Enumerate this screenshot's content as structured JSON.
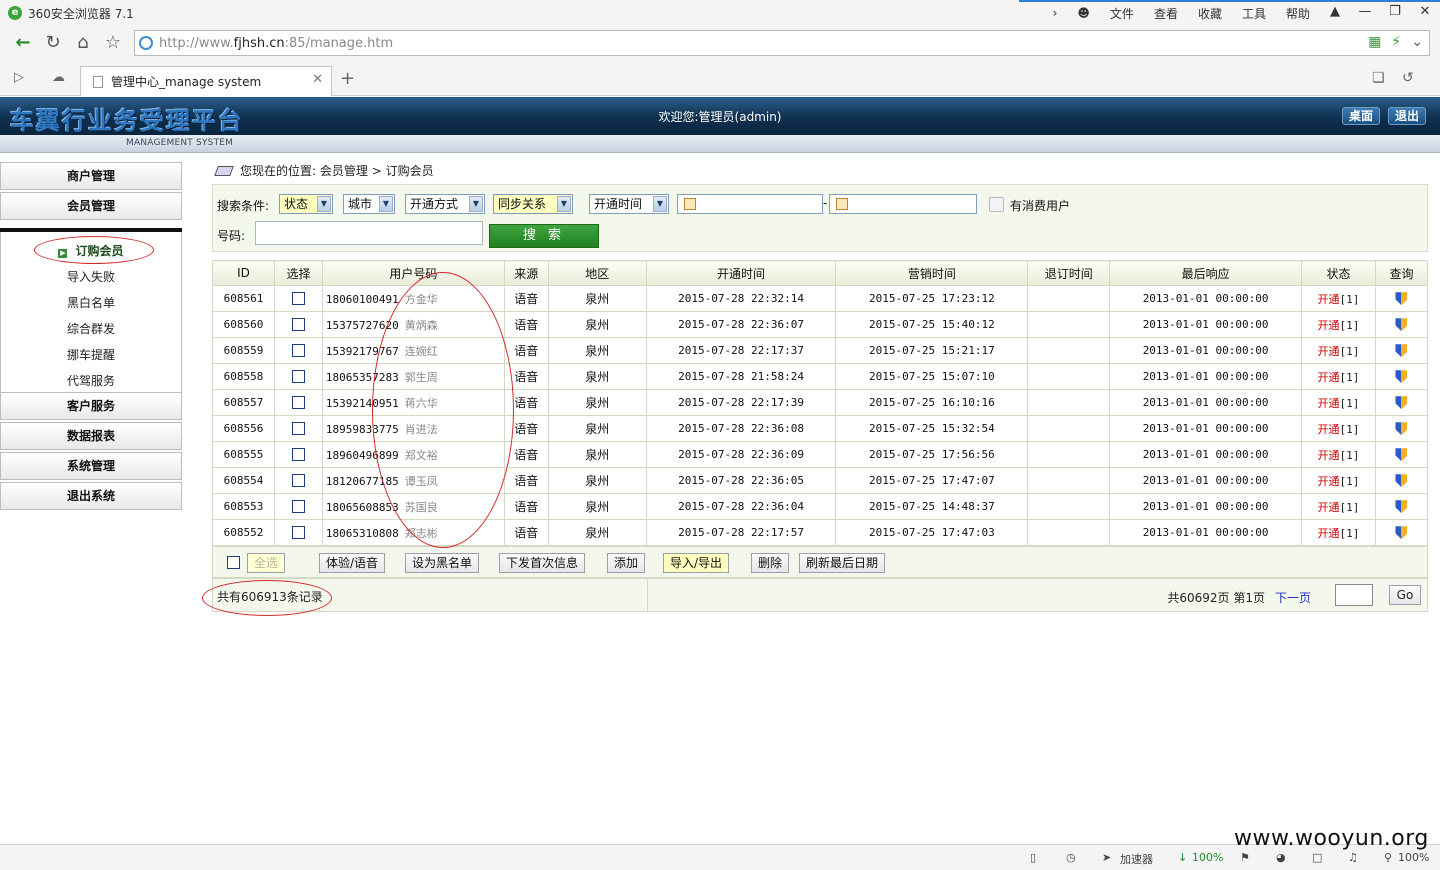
{
  "browser": {
    "app_title": "360安全浏览器 7.1",
    "menu": [
      "文件",
      "查看",
      "收藏",
      "工具",
      "帮助"
    ],
    "url_prefix": "http://www.",
    "url_domain": "fjhsh.cn",
    "url_suffix": ":85/manage.htm",
    "tab_title": "管理中心_manage system"
  },
  "header": {
    "brand": "车翼行业务受理平台",
    "subtitle": "MANAGEMENT SYSTEM",
    "welcome": "欢迎您:管理员(admin)",
    "desktop_btn": "桌面",
    "logout_btn": "退出"
  },
  "sidebar": {
    "top": [
      "商户管理",
      "会员管理"
    ],
    "sub": [
      "订购会员",
      "导入失败",
      "黑白名单",
      "综合群发",
      "挪车提醒",
      "代驾服务"
    ],
    "bottom": [
      "客户服务",
      "数据报表",
      "系统管理",
      "退出系统"
    ]
  },
  "breadcrumb": {
    "prefix": "您现在的位置:",
    "level1": "会员管理",
    "sep": ">",
    "level2": "订购会员"
  },
  "search": {
    "label": "搜索条件:",
    "status": "状态",
    "city": "城市",
    "open_method": "开通方式",
    "sync": "同步关系",
    "open_time": "开通时间",
    "dash": "-",
    "consume_label": "有消费用户",
    "number_label": "号码:",
    "button": "搜 索"
  },
  "table": {
    "headers": [
      "ID",
      "选择",
      "用户号码",
      "来源",
      "地区",
      "开通时间",
      "营销时间",
      "退订时间",
      "最后响应",
      "状态",
      "查询"
    ],
    "rows": [
      {
        "id": "608561",
        "phone": "18060100491",
        "name": "方金华",
        "source": "语音",
        "region": "泉州",
        "open_time": "2015-07-28 22:32:14",
        "market_time": "2015-07-25 17:23:12",
        "cancel_time": "",
        "last": "2013-01-01 00:00:00",
        "status": "开通",
        "count": "[1]"
      },
      {
        "id": "608560",
        "phone": "15375727620",
        "name": "黄炳森",
        "source": "语音",
        "region": "泉州",
        "open_time": "2015-07-28 22:36:07",
        "market_time": "2015-07-25 15:40:12",
        "cancel_time": "",
        "last": "2013-01-01 00:00:00",
        "status": "开通",
        "count": "[1]"
      },
      {
        "id": "608559",
        "phone": "15392179767",
        "name": "连婉红",
        "source": "语音",
        "region": "泉州",
        "open_time": "2015-07-28 22:17:37",
        "market_time": "2015-07-25 15:21:17",
        "cancel_time": "",
        "last": "2013-01-01 00:00:00",
        "status": "开通",
        "count": "[1]"
      },
      {
        "id": "608558",
        "phone": "18065357283",
        "name": "郭生周",
        "source": "语音",
        "region": "泉州",
        "open_time": "2015-07-28 21:58:24",
        "market_time": "2015-07-25 15:07:10",
        "cancel_time": "",
        "last": "2013-01-01 00:00:00",
        "status": "开通",
        "count": "[1]"
      },
      {
        "id": "608557",
        "phone": "15392140951",
        "name": "蒋六华",
        "source": "语音",
        "region": "泉州",
        "open_time": "2015-07-28 22:17:39",
        "market_time": "2015-07-25 16:10:16",
        "cancel_time": "",
        "last": "2013-01-01 00:00:00",
        "status": "开通",
        "count": "[1]"
      },
      {
        "id": "608556",
        "phone": "18959833775",
        "name": "肖进法",
        "source": "语音",
        "region": "泉州",
        "open_time": "2015-07-28 22:36:08",
        "market_time": "2015-07-25 15:32:54",
        "cancel_time": "",
        "last": "2013-01-01 00:00:00",
        "status": "开通",
        "count": "[1]"
      },
      {
        "id": "608555",
        "phone": "18960496899",
        "name": "郑文裕",
        "source": "语音",
        "region": "泉州",
        "open_time": "2015-07-28 22:36:09",
        "market_time": "2015-07-25 17:56:56",
        "cancel_time": "",
        "last": "2013-01-01 00:00:00",
        "status": "开通",
        "count": "[1]"
      },
      {
        "id": "608554",
        "phone": "18120677185",
        "name": "谭玉凤",
        "source": "语音",
        "region": "泉州",
        "open_time": "2015-07-28 22:36:05",
        "market_time": "2015-07-25 17:47:07",
        "cancel_time": "",
        "last": "2013-01-01 00:00:00",
        "status": "开通",
        "count": "[1]"
      },
      {
        "id": "608553",
        "phone": "18065608853",
        "name": "苏国良",
        "source": "语音",
        "region": "泉州",
        "open_time": "2015-07-28 22:36:04",
        "market_time": "2015-07-25 14:48:37",
        "cancel_time": "",
        "last": "2013-01-01 00:00:00",
        "status": "开通",
        "count": "[1]"
      },
      {
        "id": "608552",
        "phone": "18065310808",
        "name": "郑志彬",
        "source": "语音",
        "region": "泉州",
        "open_time": "2015-07-28 22:17:57",
        "market_time": "2015-07-25 17:47:03",
        "cancel_time": "",
        "last": "2013-01-01 00:00:00",
        "status": "开通",
        "count": "[1]"
      }
    ]
  },
  "actions": {
    "select_all": "全选",
    "trial_voice": "体验/语音",
    "set_blacklist": "设为黑名单",
    "send_first": "下发首次信息",
    "add": "添加",
    "import_export": "导入/导出",
    "delete": "删除",
    "refresh_date": "刷新最后日期"
  },
  "footer": {
    "total": "共有606913条记录",
    "pages": "共60692页",
    "current": "第1页",
    "next": "下一页",
    "go": "Go"
  },
  "statusbar": {
    "accelerator": "加速器",
    "download": "100%",
    "zoom": "100%"
  },
  "watermark": "www.wooyun.org"
}
